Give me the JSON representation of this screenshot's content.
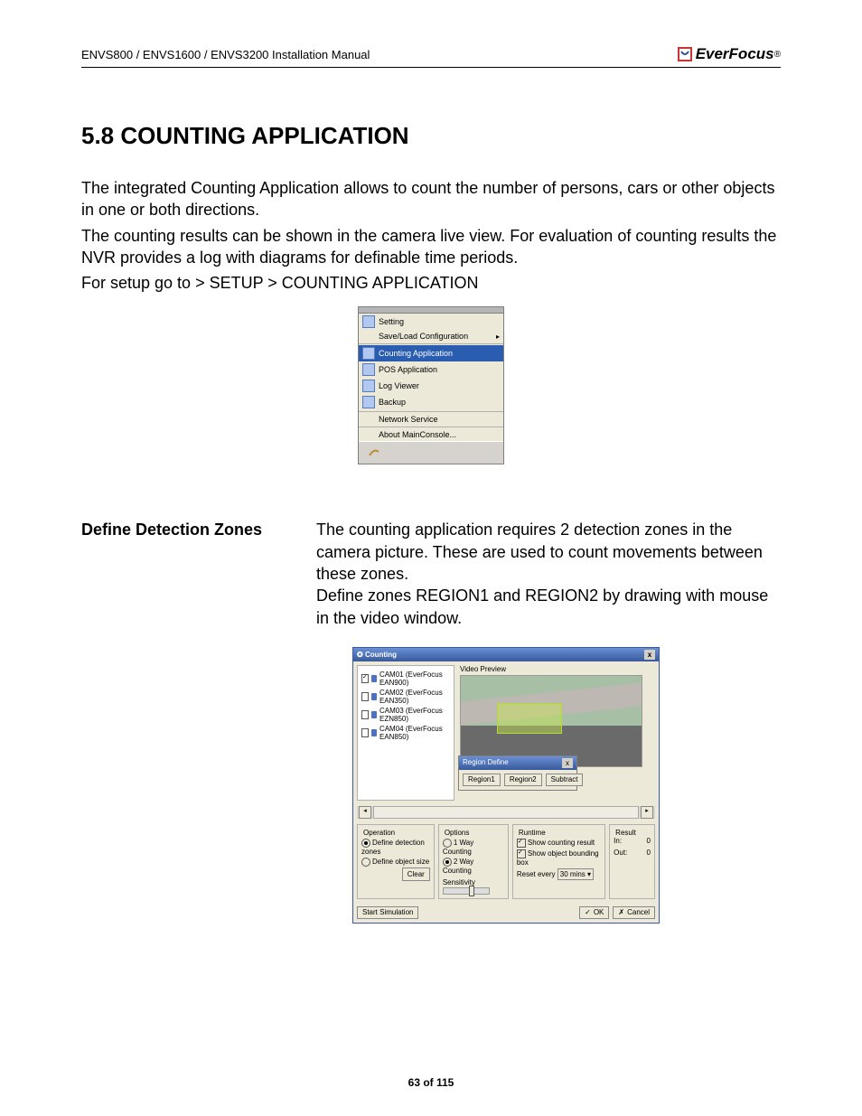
{
  "header": {
    "left": "ENVS800 / ENVS1600 / ENVS3200 Installation Manual",
    "logo": "EverFocus",
    "logo_sup": "®"
  },
  "section": {
    "number_title": "5.8   COUNTING APPLICATION"
  },
  "intro": {
    "p1": "The integrated Counting Application allows to count the number of persons, cars or other objects in one or both directions.",
    "p2": "The counting results can be shown in the camera live view. For evaluation of counting results the NVR provides a log with diagrams for definable time periods.",
    "setup": "For setup go to > SETUP > COUNTING APPLICATION"
  },
  "menu": {
    "items": [
      {
        "label": "Setting",
        "has_sub": false
      },
      {
        "label": "Save/Load Configuration",
        "has_sub": true
      }
    ],
    "items2": [
      {
        "label": "Counting Application",
        "hover": true
      },
      {
        "label": "POS Application",
        "hover": false
      },
      {
        "label": "Log Viewer",
        "hover": false
      },
      {
        "label": "Backup",
        "hover": false
      }
    ],
    "items3": [
      {
        "label": "Network Service"
      }
    ],
    "items4": [
      {
        "label": "About MainConsole..."
      }
    ]
  },
  "defn": {
    "term": "Define Detection Zones",
    "desc1": "The counting application requires 2 detection zones in the camera picture. These are used to count movements between these zones.",
    "desc2": "Define zones REGION1 and REGION2 by drawing with mouse in the video window."
  },
  "dlg": {
    "title": "Counting",
    "close": "x",
    "cams": [
      {
        "label": "CAM01 (EverFocus EAN900)",
        "checked": true
      },
      {
        "label": "CAM02 (EverFocus EAN350)",
        "checked": false
      },
      {
        "label": "CAM03 (EverFocus EZN850)",
        "checked": false
      },
      {
        "label": "CAM04 (EverFocus EAN850)",
        "checked": false
      }
    ],
    "video_label": "Video Preview",
    "region_define": {
      "title": "Region Define",
      "close": "x",
      "region1": "Region1",
      "region2": "Region2",
      "subtract": "Subtract"
    },
    "operation": {
      "title": "Operation",
      "opt1": "Define detection zones",
      "opt1_on": true,
      "opt2": "Define object size",
      "opt2_on": false,
      "clear": "Clear"
    },
    "options": {
      "title": "Options",
      "o1": "1 Way Counting",
      "o1_on": false,
      "o2": "2 Way Counting",
      "o2_on": true,
      "sens_label": "Sensitivity"
    },
    "runtime": {
      "title": "Runtime",
      "r1": "Show counting result",
      "r1_on": true,
      "r2": "Show object bounding box",
      "r2_on": true,
      "reset_label": "Reset every",
      "reset_value": "30 mins"
    },
    "result": {
      "title": "Result",
      "in_label": "In:",
      "in_value": "0",
      "out_label": "Out:",
      "out_value": "0"
    },
    "start": "Start Simulation",
    "ok": "OK",
    "cancel": "Cancel"
  },
  "footer": {
    "page": "63 of 115"
  }
}
